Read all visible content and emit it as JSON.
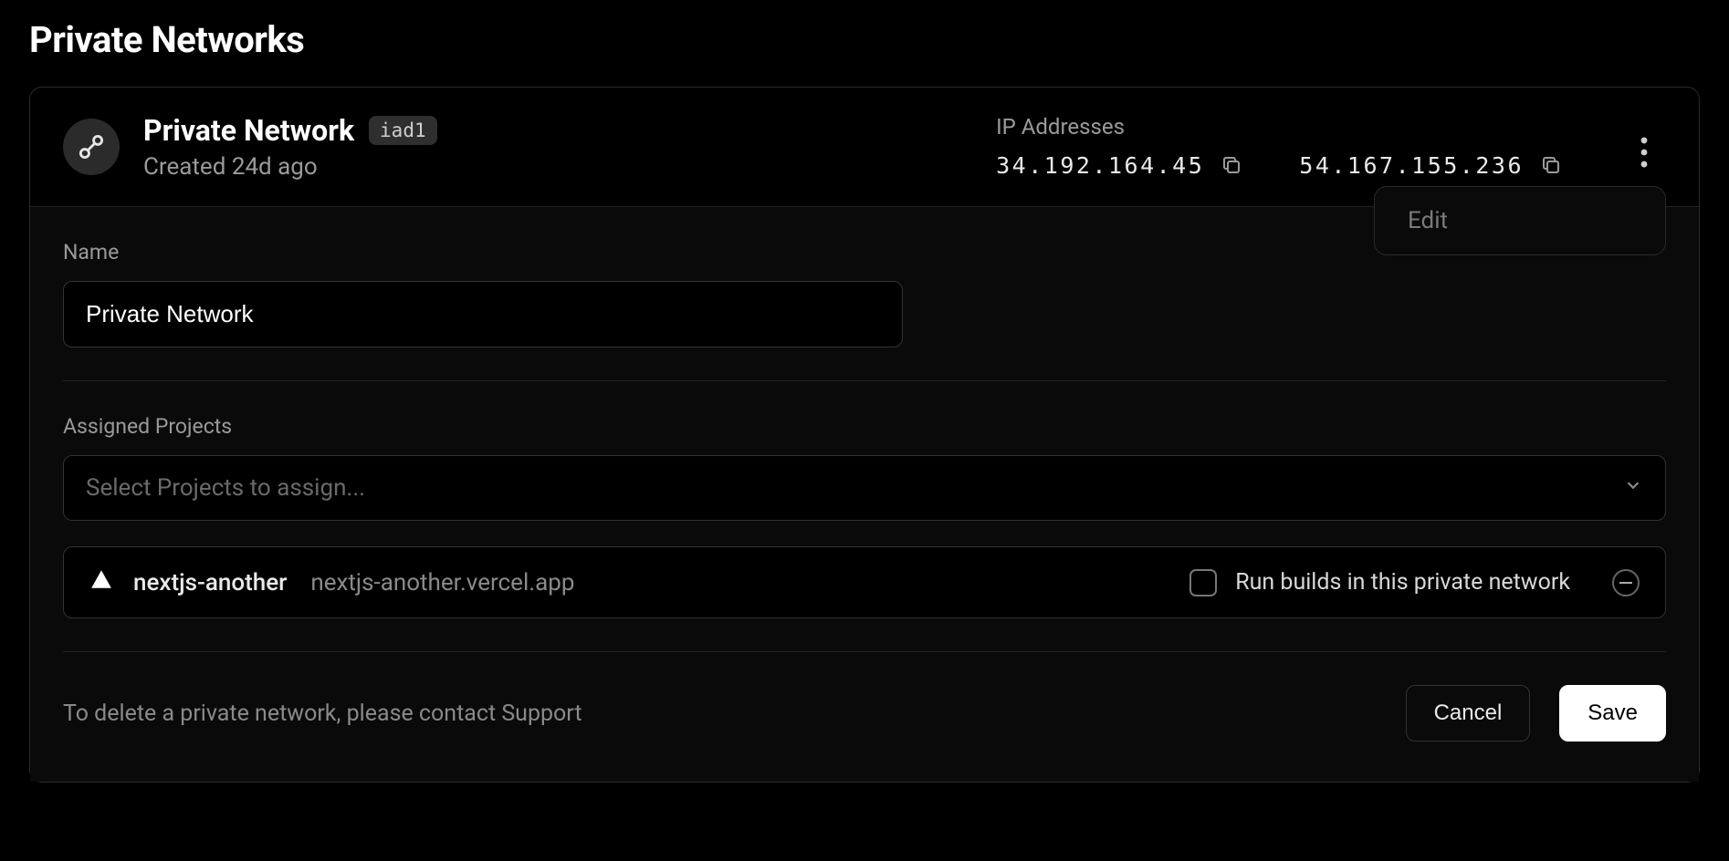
{
  "page_title": "Private Networks",
  "network": {
    "name": "Private Network",
    "region": "iad1",
    "created_text": "Created 24d ago",
    "ip_label": "IP Addresses",
    "ips": [
      "34.192.164.45",
      "54.167.155.236"
    ]
  },
  "popover": {
    "edit": "Edit"
  },
  "form": {
    "name_label": "Name",
    "name_value": "Private Network",
    "assigned_label": "Assigned Projects",
    "select_placeholder": "Select Projects to assign...",
    "project": {
      "name": "nextjs-another",
      "domain": "nextjs-another.vercel.app",
      "run_builds_label": "Run builds in this private network"
    },
    "delete_note": "To delete a private network, please contact Support",
    "cancel": "Cancel",
    "save": "Save"
  }
}
